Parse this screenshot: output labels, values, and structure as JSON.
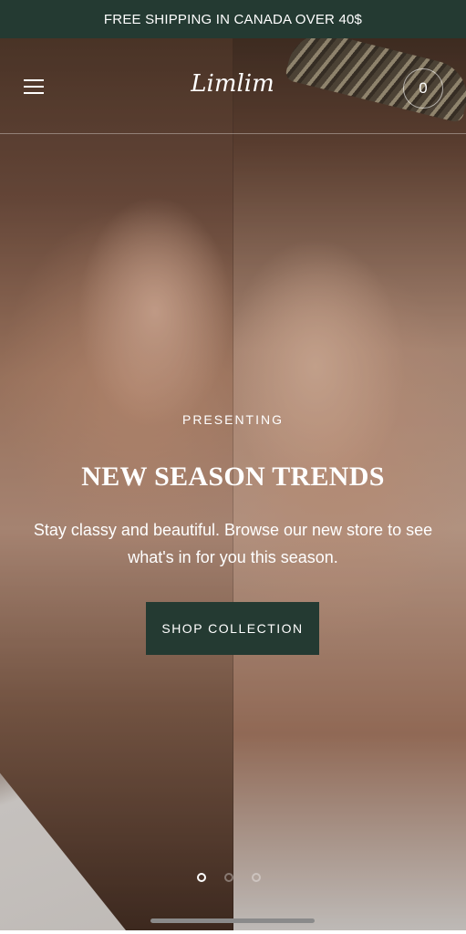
{
  "announcement": {
    "text": "FREE SHIPPING IN CANADA OVER 40$"
  },
  "header": {
    "menu_icon": "hamburger-menu-icon",
    "logo_text": "Limlim",
    "cart_count": "0"
  },
  "hero": {
    "eyebrow": "PRESENTING",
    "headline": "NEW SEASON TRENDS",
    "description": "Stay classy and beautiful. Browse our new store to see what's in for you this season.",
    "cta_label": "SHOP COLLECTION",
    "slides_total": 3,
    "active_slide": 1
  },
  "colors": {
    "brand_dark_green": "#243a32",
    "text_light": "#ffffff"
  }
}
